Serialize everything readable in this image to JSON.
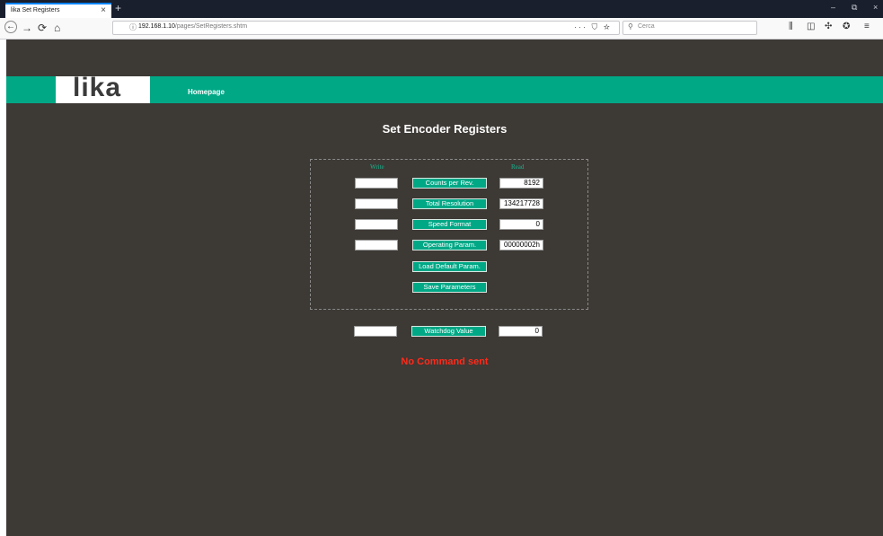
{
  "browser": {
    "tab_title": "lika Set Registers",
    "tab_close": "×",
    "new_tab": "+",
    "url_host": "192.168.1.10",
    "url_path": "/pages/SetRegisters.shtm",
    "url_actions": "··· ⛉ ☆",
    "search_placeholder": "Cerca",
    "window_controls": [
      "–",
      "⧉",
      "×"
    ]
  },
  "header": {
    "logo": "lika",
    "nav_link": "Homepage"
  },
  "main": {
    "title": "Set Encoder Registers",
    "write_label": "Write",
    "read_label": "Read",
    "rows": [
      {
        "button": "Counts per Rev.",
        "write": "",
        "read": "8192"
      },
      {
        "button": "Total Resolution",
        "write": "",
        "read": "134217728"
      },
      {
        "button": "Speed Format",
        "write": "",
        "read": "0"
      },
      {
        "button": "Operating Param.",
        "write": "",
        "read": "00000002h"
      }
    ],
    "load_default_button": "Load Default Param.",
    "save_button": "Save Parameters",
    "watchdog": {
      "button": "Watchdog Value",
      "write": "",
      "read": "0"
    },
    "status_message": "No Command sent"
  },
  "colors": {
    "accent": "#00a886",
    "page_bg": "#3d3935",
    "status": "#ff2a1a"
  }
}
